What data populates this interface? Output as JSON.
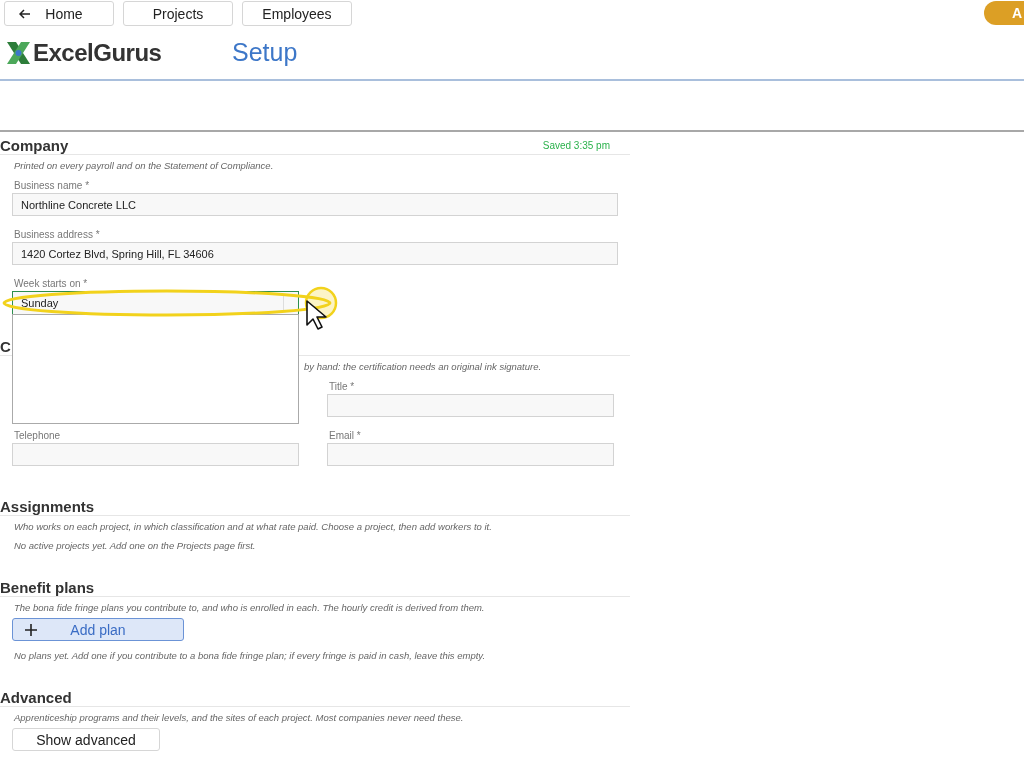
{
  "nav": [
    {
      "label": "Home",
      "kind": "back"
    },
    {
      "label": "Projects",
      "kind": "plain"
    },
    {
      "label": "Employees",
      "kind": "plain"
    }
  ],
  "account_badge": "A",
  "brand": "ExcelGurus",
  "page_title": "Setup",
  "sections": [
    {
      "title": "Company",
      "status": "Saved 3:35 pm",
      "items": [
        {
          "kind": "note",
          "text": "Printed on every payroll and on the Statement of Compliance."
        },
        {
          "kind": "field",
          "label": "Business name *",
          "value": "Northline Concrete LLC"
        },
        {
          "kind": "field",
          "label": "Business address *",
          "value": "1420 Cortez Blvd, Spring Hill, FL 34606"
        },
        {
          "kind": "select",
          "label": "Week starts on *",
          "value": "Sunday",
          "open": true
        }
      ]
    },
    {
      "title": "C",
      "items": [
        {
          "kind": "note",
          "text": "by hand: the certification needs an original ink signature.",
          "indent": true
        },
        {
          "kind": "grid",
          "cells": [
            {
              "kind": "covered"
            },
            {
              "kind": "field",
              "label": "Title *"
            },
            {
              "kind": "field",
              "label": "Telephone"
            },
            {
              "kind": "field",
              "label": "Email *"
            }
          ]
        }
      ]
    },
    {
      "title": "Assignments",
      "items": [
        {
          "kind": "note",
          "text": "Who works on each project, in which classification and at what rate paid. Choose a project, then add workers to it."
        },
        {
          "kind": "note",
          "text": "No active projects yet. Add one on the Projects page first."
        }
      ]
    },
    {
      "title": "Benefit plans",
      "items": [
        {
          "kind": "note",
          "text": "The bona fide fringe plans you contribute to, and who is enrolled in each. The hourly credit is derived from them."
        },
        {
          "kind": "button",
          "label": "Add plan",
          "primary": true
        },
        {
          "kind": "note",
          "text": "No plans yet. Add one if you contribute to a bona fide fringe plan; if every fringe is paid in cash, leave this empty."
        }
      ]
    },
    {
      "title": "Advanced",
      "items": [
        {
          "kind": "note",
          "text": "Apprenticeship programs and their levels, and the sites of each project. Most companies never need these."
        },
        {
          "kind": "button",
          "label": "Show advanced",
          "primary": false
        }
      ]
    }
  ]
}
